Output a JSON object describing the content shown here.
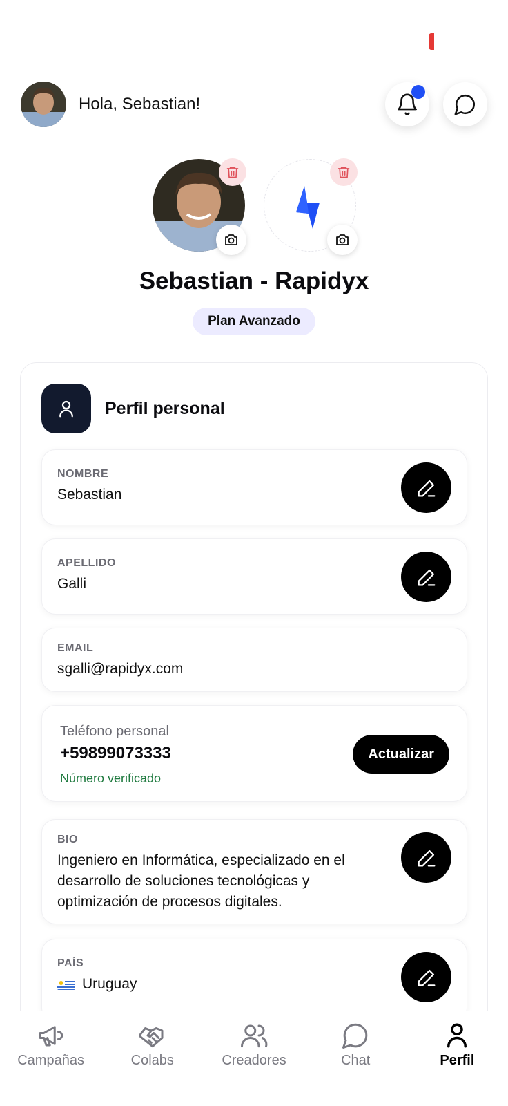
{
  "header": {
    "greeting": "Hola, Sebastian!"
  },
  "profile": {
    "display_name": "Sebastian - Rapidyx",
    "plan": "Plan Avanzado"
  },
  "section": {
    "title": "Perfil personal"
  },
  "fields": {
    "nombre": {
      "label": "NOMBRE",
      "value": "Sebastian"
    },
    "apellido": {
      "label": "APELLIDO",
      "value": "Galli"
    },
    "email": {
      "label": "EMAIL",
      "value": "sgalli@rapidyx.com"
    },
    "telefono": {
      "label": "Teléfono personal",
      "value": "+59899073333",
      "status": "Número verificado",
      "button": "Actualizar"
    },
    "bio": {
      "label": "BIO",
      "value": "Ingeniero en Informática, especializado en el desarrollo de soluciones tecnológicas y optimización de procesos digitales."
    },
    "pais": {
      "label": "PAÍS",
      "value": "Uruguay",
      "flag": "uruguay-flag-icon"
    }
  },
  "tabs": [
    {
      "label": "Campañas",
      "icon": "megaphone-icon"
    },
    {
      "label": "Colabs",
      "icon": "handshake-icon"
    },
    {
      "label": "Creadores",
      "icon": "users-icon"
    },
    {
      "label": "Chat",
      "icon": "chat-bubble-icon"
    },
    {
      "label": "Perfil",
      "icon": "person-icon",
      "active": true
    }
  ],
  "colors": {
    "accent": "#1f4ff5",
    "dark_card": "#121a2e",
    "plan_bg": "#ecebff",
    "verified": "#1f7a3f",
    "danger_bg": "#fbe1e3"
  }
}
